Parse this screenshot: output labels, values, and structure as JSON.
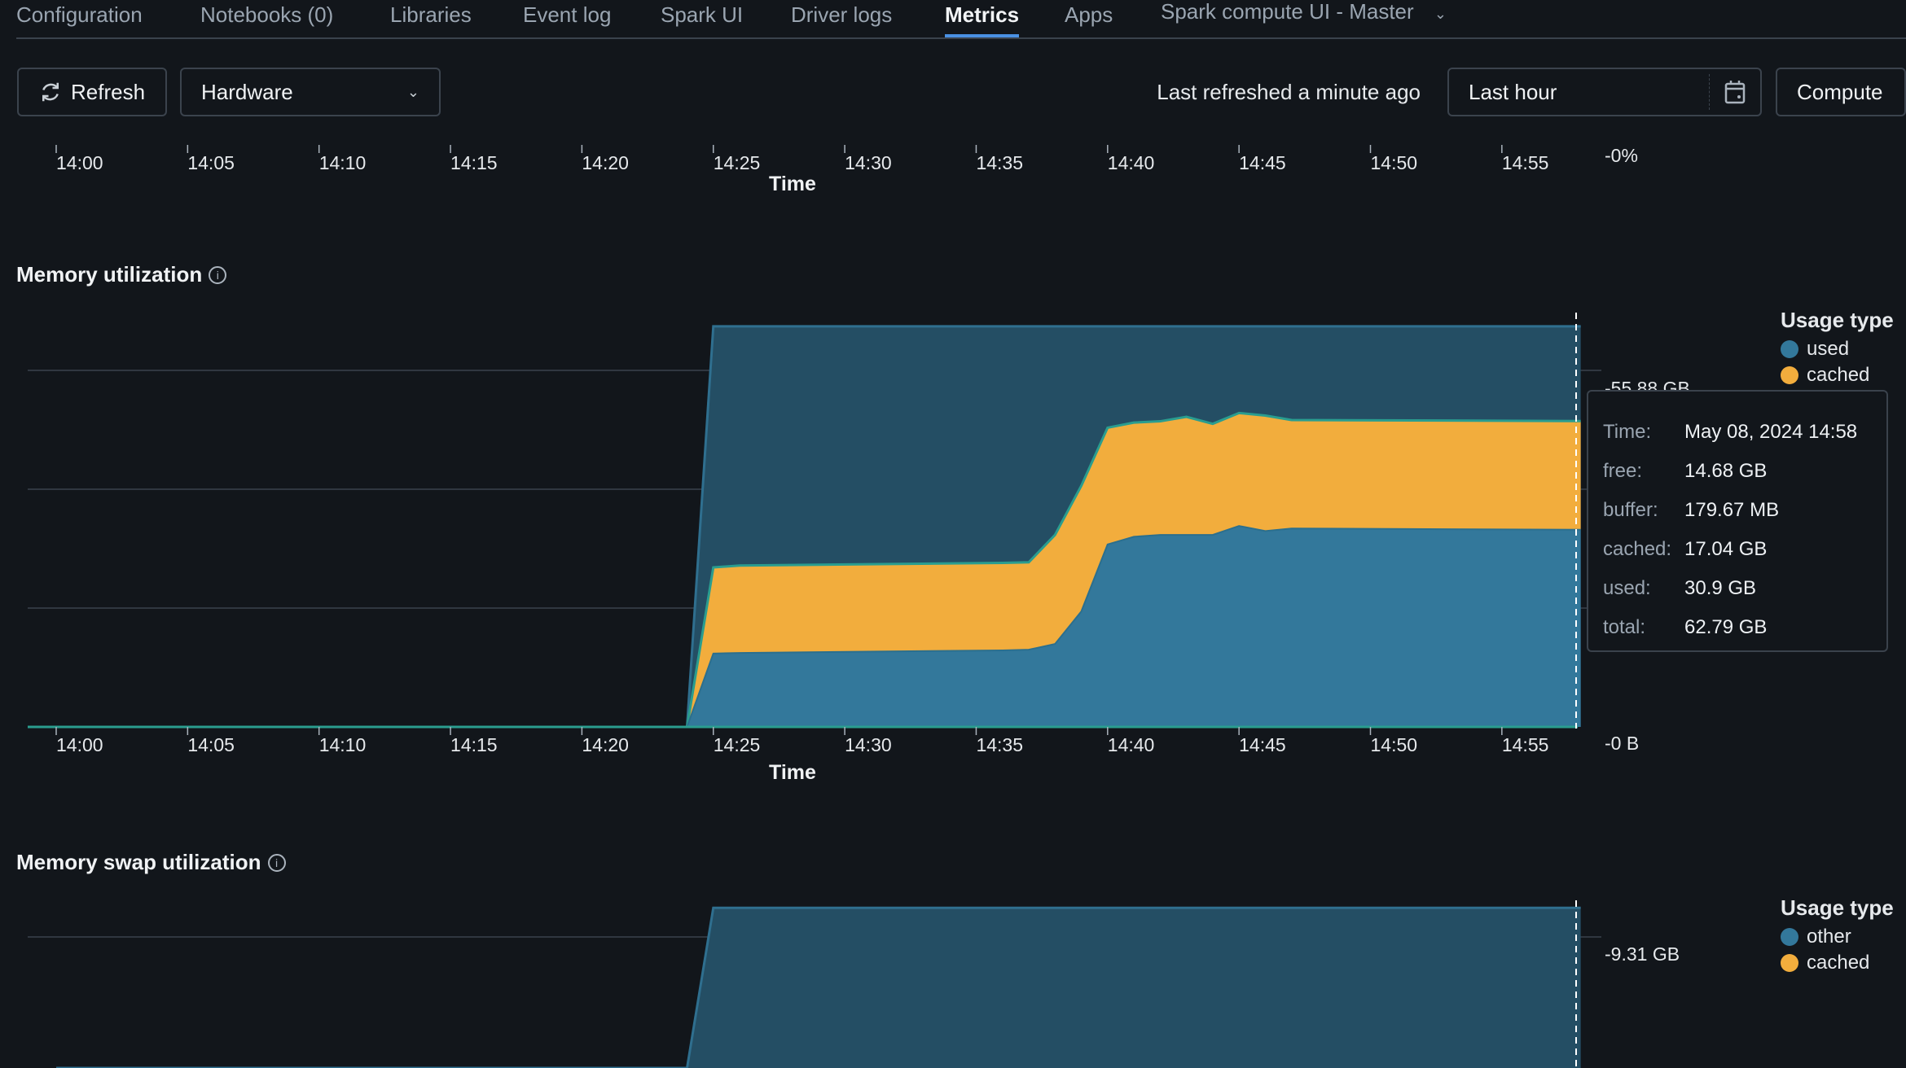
{
  "tabs": [
    {
      "label": "Configuration",
      "active": false
    },
    {
      "label": "Notebooks (0)",
      "active": false
    },
    {
      "label": "Libraries",
      "active": false
    },
    {
      "label": "Event log",
      "active": false
    },
    {
      "label": "Spark UI",
      "active": false
    },
    {
      "label": "Driver logs",
      "active": false
    },
    {
      "label": "Metrics",
      "active": true
    },
    {
      "label": "Apps",
      "active": false
    },
    {
      "label": "Spark compute UI - Master",
      "active": false,
      "dropdown": true
    }
  ],
  "toolbar": {
    "refresh_label": "Refresh",
    "metric_select": "Hardware",
    "last_refreshed": "Last refreshed a minute ago",
    "time_range": "Last hour",
    "compute_label": "Compute"
  },
  "colors": {
    "accent": "#4a90e2",
    "used": "#33789b",
    "cached": "#f2ad3d",
    "free": "#244e64",
    "line": "#2a9d8f"
  },
  "chart_data": [
    {
      "type": "area",
      "xlabel": "Time",
      "x_ticks": [
        "14:00",
        "14:05",
        "14:10",
        "14:15",
        "14:20",
        "14:25",
        "14:30",
        "14:35",
        "14:40",
        "14:45",
        "14:50",
        "14:55"
      ],
      "y_ticks": [
        "0%"
      ]
    },
    {
      "type": "area",
      "title": "Memory utilization",
      "xlabel": "Time",
      "legend_title": "Usage type",
      "legend_position": "top-right",
      "x_ticks": [
        "14:00",
        "14:05",
        "14:10",
        "14:15",
        "14:20",
        "14:25",
        "14:30",
        "14:35",
        "14:40",
        "14:45",
        "14:50",
        "14:55"
      ],
      "y_ticks": [
        "0 B",
        "55.88 GB"
      ],
      "ylim_gb": [
        0,
        62.79
      ],
      "x": [
        "14:00",
        "14:24",
        "14:25",
        "14:26",
        "14:36",
        "14:37",
        "14:38",
        "14:39",
        "14:40",
        "14:41",
        "14:42",
        "14:43",
        "14:44",
        "14:45",
        "14:46",
        "14:47",
        "14:58"
      ],
      "series": [
        {
          "name": "used",
          "values": [
            0,
            0,
            11.5,
            11.6,
            12.0,
            12.1,
            13.0,
            18.1,
            28.6,
            29.8,
            30.1,
            30.1,
            30.1,
            31.5,
            30.7,
            31.1,
            30.9
          ]
        },
        {
          "name": "cached",
          "values": [
            0,
            0,
            13.5,
            13.7,
            13.7,
            13.7,
            17.1,
            19.7,
            18.3,
            17.9,
            17.8,
            18.5,
            17.4,
            17.7,
            18.1,
            17.0,
            17.04
          ]
        },
        {
          "name": "total",
          "values": [
            0,
            0,
            62.79,
            62.79,
            62.79,
            62.79,
            62.79,
            62.79,
            62.79,
            62.79,
            62.79,
            62.79,
            62.79,
            62.79,
            62.79,
            62.79,
            62.79
          ]
        }
      ],
      "legend": [
        "used",
        "cached"
      ],
      "tooltip": {
        "rows": [
          {
            "k": "Time:",
            "v": "May 08, 2024 14:58"
          },
          {
            "k": "free:",
            "v": "14.68 GB"
          },
          {
            "k": "buffer:",
            "v": "179.67 MB"
          },
          {
            "k": "cached:",
            "v": "17.04 GB"
          },
          {
            "k": "used:",
            "v": "30.9 GB"
          },
          {
            "k": "total:",
            "v": "62.79 GB"
          }
        ]
      }
    },
    {
      "type": "area",
      "title": "Memory swap utilization",
      "legend_title": "Usage type",
      "legend_position": "top-right",
      "legend": [
        "other",
        "cached"
      ],
      "y_ticks": [
        "9.31 GB"
      ],
      "x": [
        "14:00",
        "14:24",
        "14:25",
        "14:58"
      ],
      "series": [
        {
          "name": "total",
          "values": [
            0,
            0,
            10.08,
            10.08
          ]
        }
      ]
    }
  ]
}
